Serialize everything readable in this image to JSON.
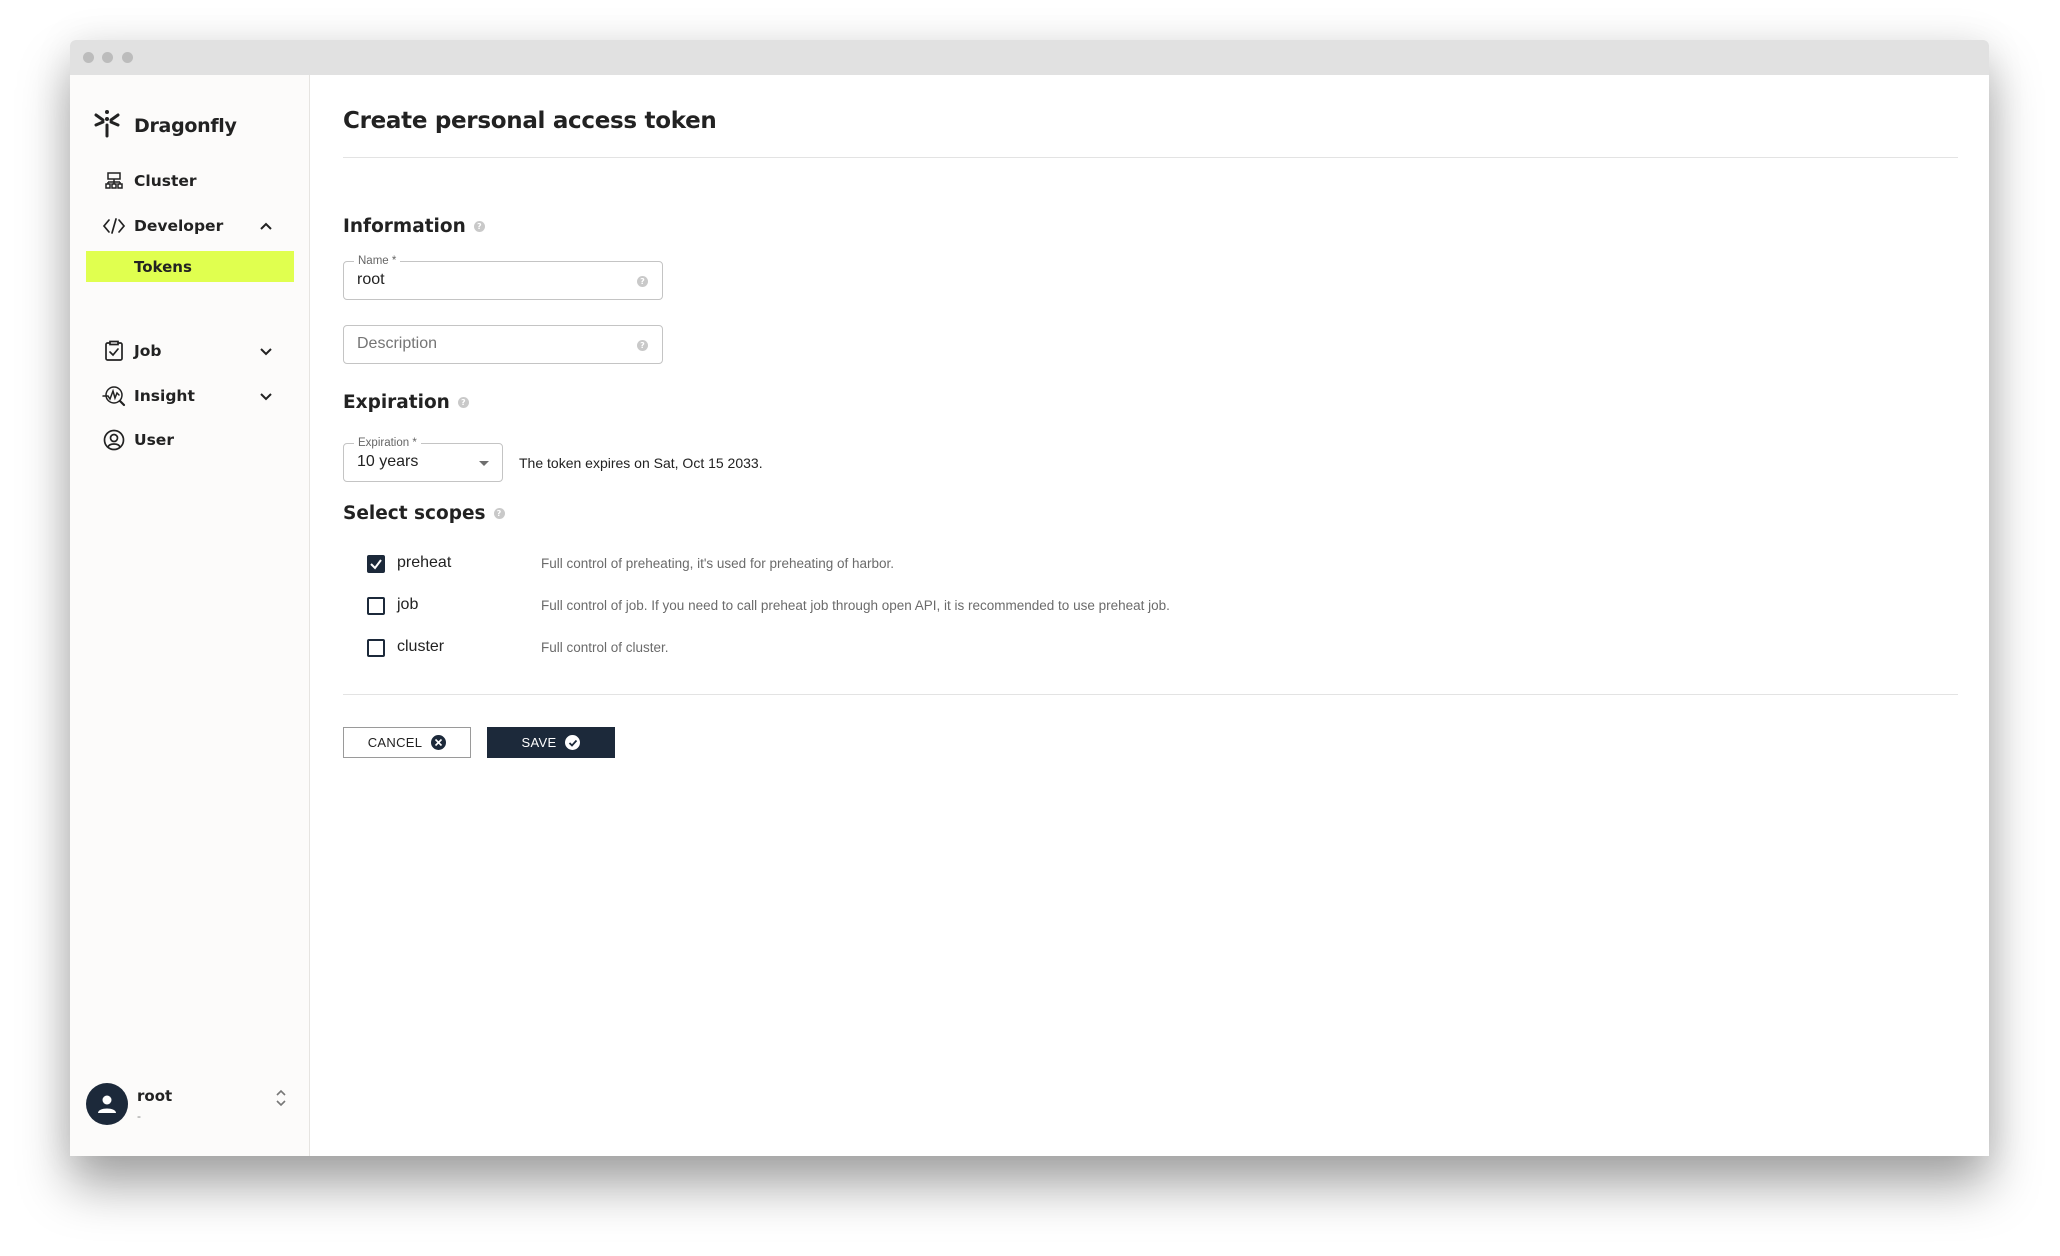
{
  "app": {
    "name": "Dragonfly"
  },
  "sidebar": {
    "items": [
      {
        "label": "Cluster",
        "icon": "cluster-icon"
      },
      {
        "label": "Developer",
        "icon": "code-icon",
        "expanded": true
      },
      {
        "label": "Tokens",
        "active": true
      },
      {
        "label": "Job",
        "icon": "clipboard-check-icon",
        "expanded": false
      },
      {
        "label": "Insight",
        "icon": "insight-search-icon",
        "expanded": false
      },
      {
        "label": "User",
        "icon": "user-circle-icon"
      }
    ],
    "user": {
      "name": "root",
      "subtitle": "-"
    }
  },
  "page": {
    "title": "Create personal access token",
    "information": {
      "heading": "Information",
      "name_label": "Name *",
      "name_value": "root",
      "description_placeholder": "Description"
    },
    "expiration": {
      "heading": "Expiration",
      "label": "Expiration *",
      "selected": "10 years",
      "note": "The token expires on Sat, Oct 15 2033."
    },
    "scopes": {
      "heading": "Select scopes",
      "items": [
        {
          "name": "preheat",
          "checked": true,
          "description": "Full control of preheating, it's used for preheating of harbor."
        },
        {
          "name": "job",
          "checked": false,
          "description": "Full control of job. If you need to call preheat job through open API, it is recommended to use preheat job."
        },
        {
          "name": "cluster",
          "checked": false,
          "description": "Full control of cluster."
        }
      ]
    },
    "actions": {
      "cancel": "CANCEL",
      "save": "SAVE"
    }
  },
  "colors": {
    "accent": "#e0ff4f",
    "primary": "#1c293a"
  }
}
